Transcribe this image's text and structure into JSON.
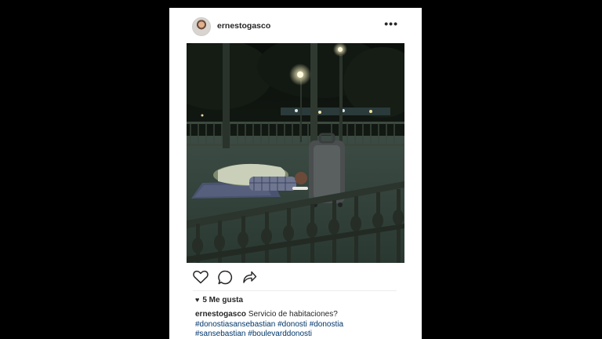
{
  "post": {
    "username": "ernestogasco",
    "more_label": "•••",
    "likes": {
      "heart_icon": "♥",
      "text": "5 Me gusta"
    },
    "caption": {
      "username": "ernestogasco",
      "text": "Servicio de habitaciones?",
      "hashtags": [
        "#donostiasansebastian",
        "#donosti",
        "#donostia",
        "#sansebastian",
        "#boulevarddonosti"
      ]
    }
  },
  "icons": [
    "heart-outline-icon",
    "comment-icon",
    "share-icon",
    "more-icon"
  ],
  "colors": {
    "background": "#000000",
    "card": "#ffffff",
    "text": "#262626",
    "hashtag": "#003569"
  }
}
